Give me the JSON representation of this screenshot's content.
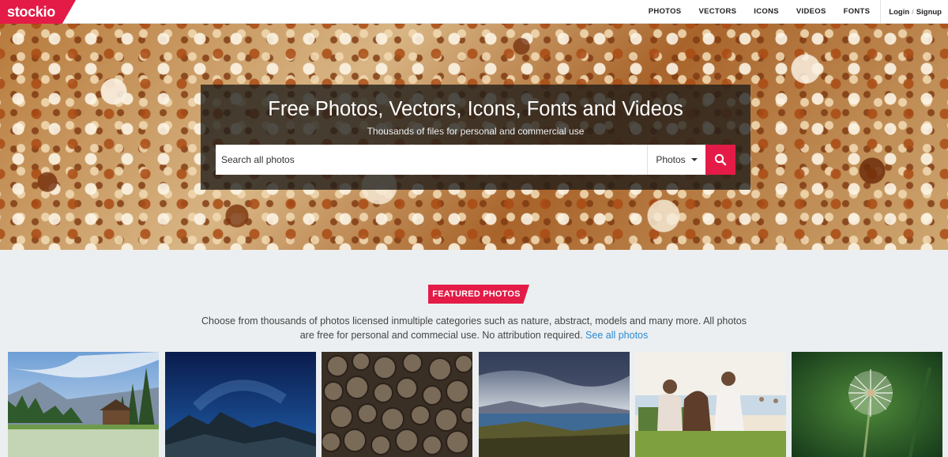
{
  "header": {
    "logo_text": "stockio",
    "nav": [
      "PHOTOS",
      "VECTORS",
      "ICONS",
      "VIDEOS",
      "FONTS"
    ],
    "login": "Login",
    "separator": "/",
    "signup": "Signup"
  },
  "hero": {
    "title": "Free Photos, Vectors, Icons, Fonts and Videos",
    "subtitle": "Thousands of files for personal and commercial use",
    "search_placeholder": "Search all photos",
    "search_type": "Photos",
    "search_icon": "search-icon"
  },
  "featured": {
    "badge": "FEATURED PHOTOS",
    "description": "Choose from thousands of photos licensed inmultiple categories such as nature, abstract, models and many more. All photos are free for personal and commecial use. No attribution required.",
    "see_all": "See all photos"
  },
  "colors": {
    "accent": "#e41b47",
    "link": "#2c8ad1",
    "section_bg": "#eceff1"
  }
}
